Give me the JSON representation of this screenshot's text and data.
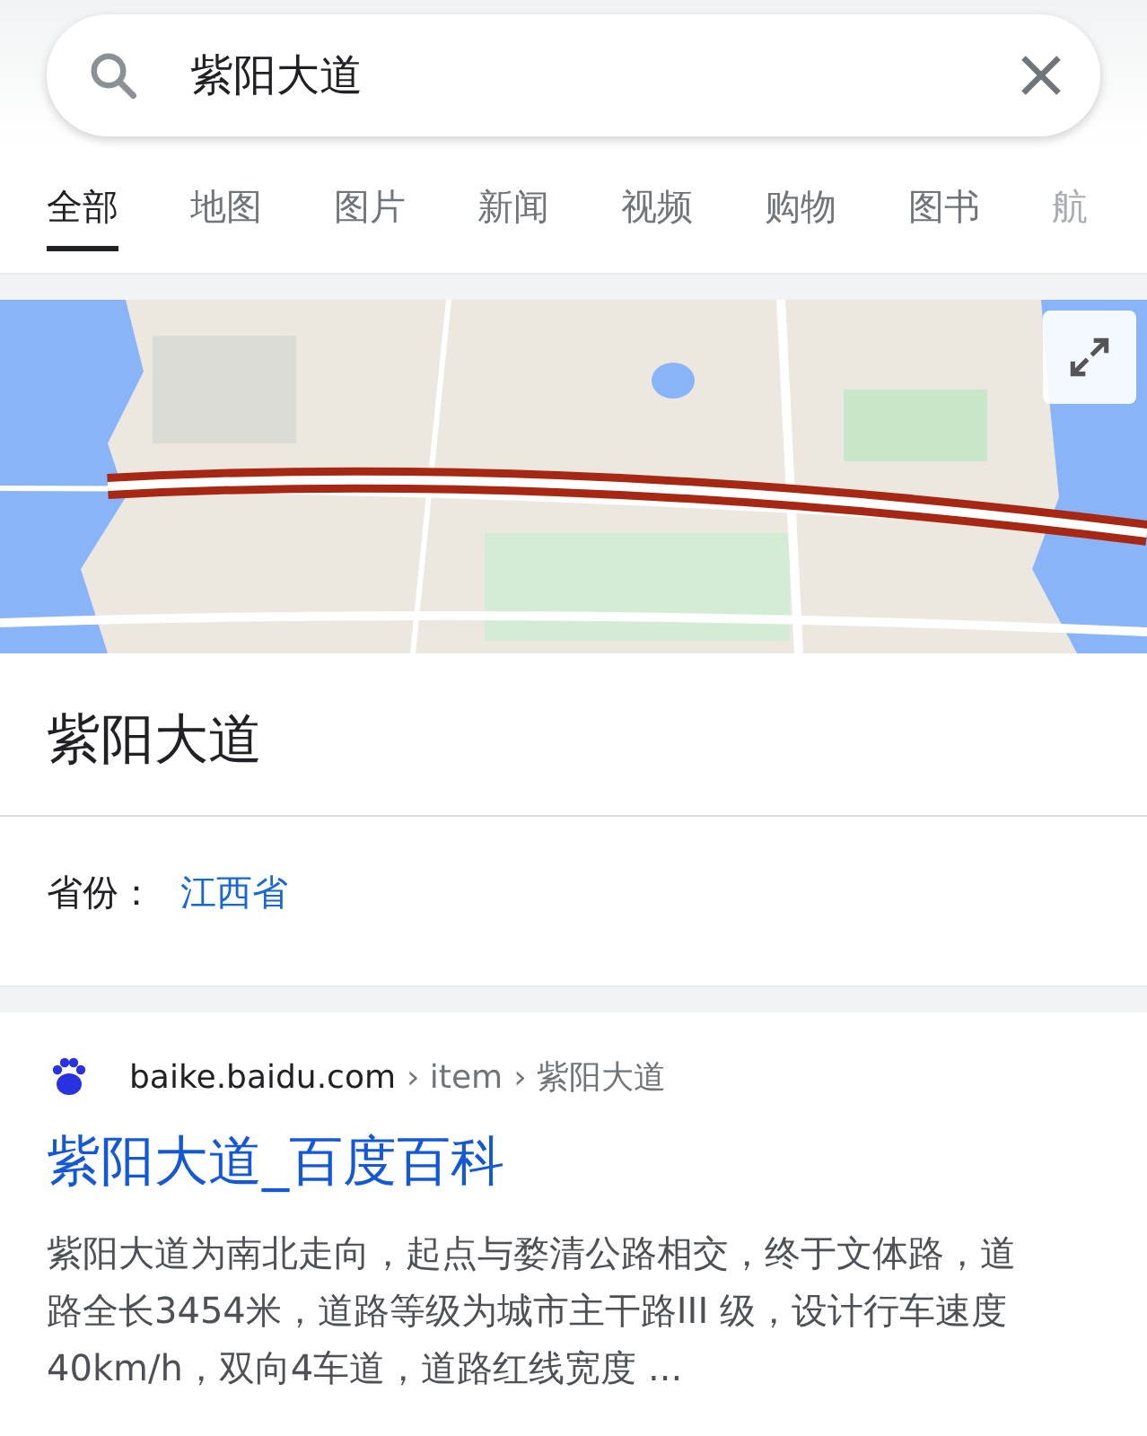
{
  "search": {
    "value": "紫阳大道"
  },
  "tabs": [
    {
      "label": "全部",
      "selected": true
    },
    {
      "label": "地图",
      "selected": false
    },
    {
      "label": "图片",
      "selected": false
    },
    {
      "label": "新闻",
      "selected": false
    },
    {
      "label": "视频",
      "selected": false
    },
    {
      "label": "购物",
      "selected": false
    },
    {
      "label": "图书",
      "selected": false
    },
    {
      "label": "航",
      "selected": false,
      "faded": true
    }
  ],
  "place": {
    "title": "紫阳大道",
    "attribute_label": "省份：",
    "attribute_value": "江西省"
  },
  "result": {
    "domain": "baike.baidu.com",
    "path": [
      "› item",
      "› 紫阳大道"
    ],
    "title": "紫阳大道_百度百科",
    "snippet": "紫阳大道为南北走向，起点与婺清公路相交，终于文体路，道路全长3454米，道路等级为城市主干路III 级，设计行车速度40km/h，双向4车道，道路红线宽度 ..."
  }
}
